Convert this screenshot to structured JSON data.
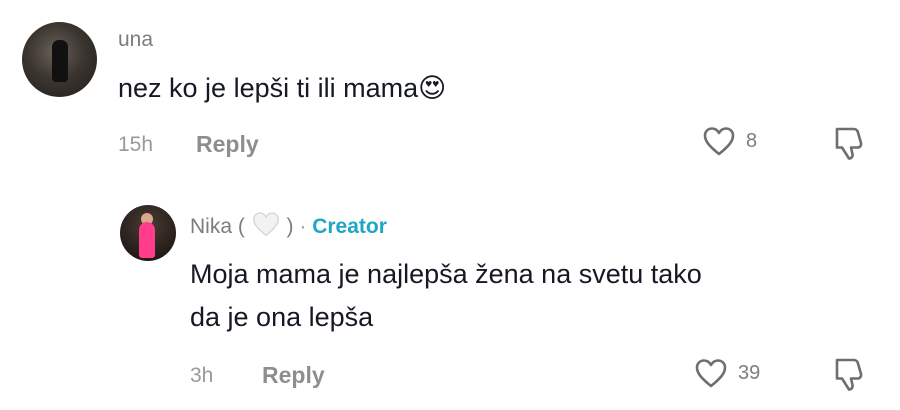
{
  "comments": [
    {
      "username": "una",
      "text": "nez ko je lepši ti ili mama",
      "emoji": "😍",
      "time": "15h",
      "reply_label": "Reply",
      "likes": "8"
    },
    {
      "username_prefix": "Nika (",
      "username_suffix": ")",
      "separator": "·",
      "creator_label": "Creator",
      "text_line1": "Moja mama je najlepša žena na svetu tako",
      "text_line2": "da je ona lepša",
      "time": "3h",
      "reply_label": "Reply",
      "likes": "39"
    }
  ],
  "icons": {
    "heart": "heart-outline-icon",
    "white_heart": "white-heart-icon",
    "dislike": "dislike-icon",
    "emoji": "heart-eyes-emoji"
  },
  "colors": {
    "text": "#161823",
    "muted": "#8e8e8e",
    "creator": "#1ea7c4"
  }
}
